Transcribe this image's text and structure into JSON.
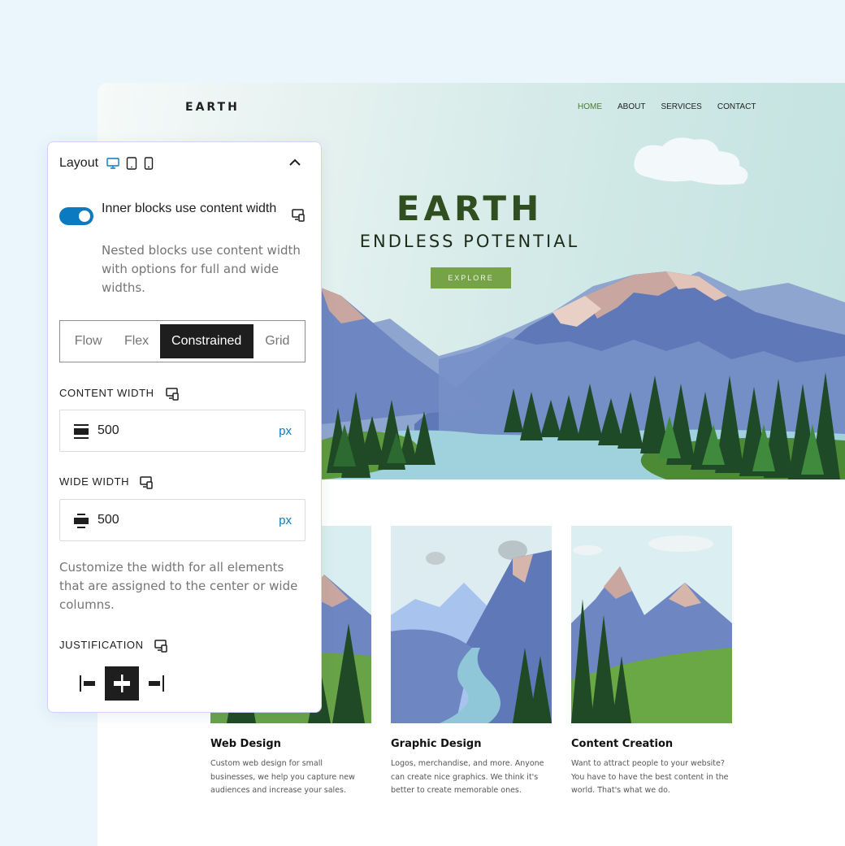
{
  "site": {
    "logo": "EARTH",
    "nav": [
      "HOME",
      "ABOUT",
      "SERVICES",
      "CONTACT"
    ],
    "active_nav": "HOME",
    "hero_title": "EARTH",
    "hero_subtitle": "ENDLESS POTENTIAL",
    "cta_label": "EXPLORE",
    "cards": [
      {
        "title": "Web Design",
        "text": "Custom web design for small businesses, we help you capture new audiences and increase your sales."
      },
      {
        "title": "Graphic Design",
        "text": "Logos, merchandise, and more. Anyone can create nice graphics. We think it's better to create memorable ones."
      },
      {
        "title": "Content Creation",
        "text": "Want to attract people to your website? You have to have the best content in the world. That's what we do."
      }
    ]
  },
  "panel": {
    "title": "Layout",
    "device_icons": [
      "desktop-icon",
      "tablet-icon",
      "mobile-icon"
    ],
    "toggle_label": "Inner blocks use content width",
    "toggle_on": true,
    "toggle_help": "Nested blocks use content width with options for full and wide widths.",
    "layout_types": [
      "Flow",
      "Flex",
      "Constrained",
      "Grid"
    ],
    "selected_layout": "Constrained",
    "content_width": {
      "label": "CONTENT WIDTH",
      "value": "500",
      "unit": "px"
    },
    "wide_width": {
      "label": "WIDE WIDTH",
      "value": "500",
      "unit": "px"
    },
    "width_help": "Customize the width for all elements that are assigned to the center or wide columns.",
    "justification": {
      "label": "JUSTIFICATION",
      "options": [
        "left",
        "center",
        "right"
      ],
      "selected": "center"
    }
  },
  "colors": {
    "accent": "#0b7ac1",
    "hero_title": "#2f4f20",
    "cta": "#76a347",
    "panel_border": "#d8cffa"
  }
}
